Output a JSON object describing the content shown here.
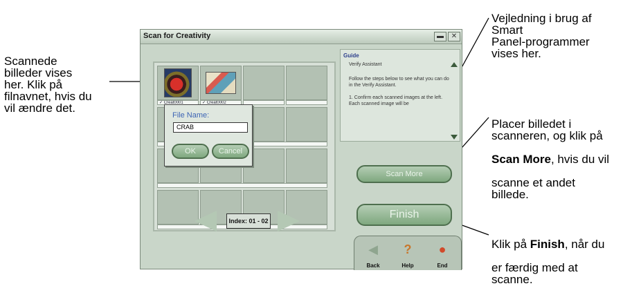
{
  "window": {
    "title": "Scan for Creativity",
    "minimize_glyph": "▬",
    "close_glyph": "✕"
  },
  "grid": {
    "thumbnails": [
      {
        "filename": "Creat0001"
      },
      {
        "filename": "Creat0002"
      }
    ]
  },
  "filename_dialog": {
    "label": "File Name:",
    "value": "CRAB",
    "ok_label": "OK",
    "cancel_label": "Cancel"
  },
  "navigation": {
    "index_label": "Index: 01 - 02"
  },
  "guide": {
    "title": "Guide",
    "heading": "Verify Assistant",
    "body": "Follow the steps below to see what you can do in the Verify Assistant.\n\n1. Confirm each scanned images at the left. Each scanned image will be"
  },
  "buttons": {
    "scan_more": "Scan More",
    "finish": "Finish"
  },
  "iconbar": {
    "back": "Back",
    "help": "Help",
    "end": "End"
  },
  "callouts": {
    "left": "Scannede\nbilleder vises\nher. Klik på\nfilnavnet, hvis du\nvil ændre det.",
    "top_right": "Vejledning i brug af\nSmart\nPanel-programmer\nvises her.",
    "mid_right_1": "Placer billedet i\nscanneren, og klik på",
    "mid_right_bold": "Scan More",
    "mid_right_2": ", hvis du vil",
    "mid_right_3": "scanne et andet\nbillede.",
    "bottom_right_1": "Klik på ",
    "bottom_right_bold": "Finish",
    "bottom_right_2": ", når du",
    "bottom_right_3": "er færdig med at\nscanne."
  },
  "colors": {
    "accent_label": "#3c64b4",
    "window_bg": "#c9d6c9"
  }
}
